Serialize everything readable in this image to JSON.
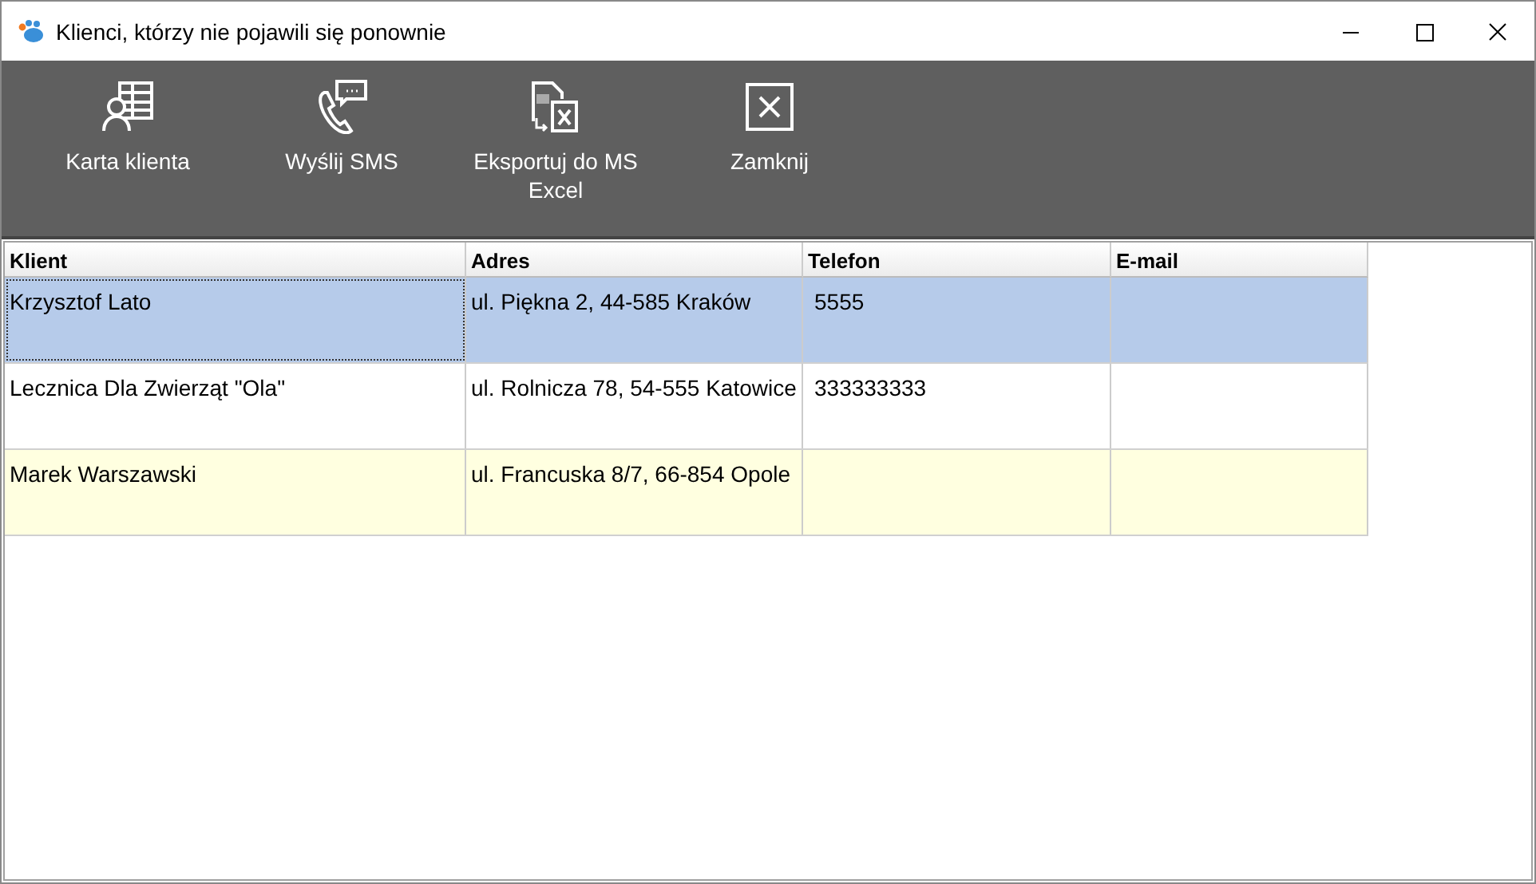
{
  "window": {
    "title": "Klienci, którzy nie pojawili się ponownie"
  },
  "toolbar": [
    {
      "kind": "card",
      "label": "Karta klienta"
    },
    {
      "kind": "sms",
      "label": "Wyślij SMS"
    },
    {
      "kind": "export",
      "label": "Eksportuj do MS Excel"
    },
    {
      "kind": "close",
      "label": "Zamknij"
    }
  ],
  "table": {
    "columns": [
      "Klient",
      "Adres",
      "Telefon",
      "E-mail"
    ],
    "rows": [
      {
        "selected": true,
        "cells": [
          "Krzysztof Lato",
          "ul. Piękna 2, 44-585 Kraków",
          "5555"
        ]
      },
      {
        "selected": false,
        "cells": [
          "Lecznica Dla Zwierząt \"Ola\"",
          "ul. Rolnicza 78, 54-555 Katowice",
          "333333333"
        ]
      },
      {
        "selected": false,
        "cells": [
          "Marek Warszawski",
          "ul. Francuska 8/7, 66-854 Opole"
        ]
      }
    ]
  }
}
